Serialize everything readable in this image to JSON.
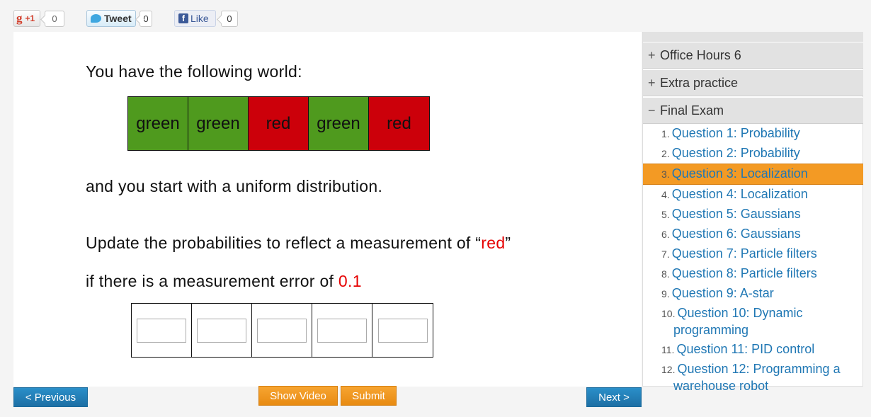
{
  "social": {
    "gplus_label": "+1",
    "gplus_count": "0",
    "tweet_label": "Tweet",
    "tweet_count": "0",
    "like_label": "Like",
    "like_count": "0"
  },
  "question": {
    "line1": "You have the following world:",
    "world": [
      {
        "label": "green",
        "color": "#4f9a1e"
      },
      {
        "label": "green",
        "color": "#4f9a1e"
      },
      {
        "label": "red",
        "color": "#cc000a"
      },
      {
        "label": "green",
        "color": "#4f9a1e"
      },
      {
        "label": "red",
        "color": "#cc000a"
      }
    ],
    "line2": "and you start with a uniform distribution.",
    "line3_pre": "Update the probabilities to reflect a measurement of “",
    "line3_red": "red",
    "line3_post": "”",
    "line4_pre": "if there is a measurement error of ",
    "line4_red": "0.1",
    "answers": [
      "",
      "",
      "",
      "",
      ""
    ]
  },
  "buttons": {
    "previous": "< Previous",
    "show_video": "Show Video",
    "submit": "Submit",
    "next": "Next >"
  },
  "sidebar": {
    "sections": [
      {
        "toggle": "+",
        "label": "Office Hours 6"
      },
      {
        "toggle": "+",
        "label": "Extra practice"
      },
      {
        "toggle": "−",
        "label": "Final Exam"
      }
    ],
    "questions": [
      {
        "num": "1.",
        "label": "Question 1: Probability"
      },
      {
        "num": "2.",
        "label": "Question 2: Probability"
      },
      {
        "num": "3.",
        "label": "Question 3: Localization",
        "active": true
      },
      {
        "num": "4.",
        "label": "Question 4: Localization"
      },
      {
        "num": "5.",
        "label": "Question 5: Gaussians"
      },
      {
        "num": "6.",
        "label": "Question 6: Gaussians"
      },
      {
        "num": "7.",
        "label": "Question 7: Particle filters"
      },
      {
        "num": "8.",
        "label": "Question 8: Particle filters"
      },
      {
        "num": "9.",
        "label": "Question 9: A-star"
      },
      {
        "num": "10.",
        "label": "Question 10: Dynamic",
        "cont": "programming"
      },
      {
        "num": "11.",
        "label": "Question 11: PID control"
      },
      {
        "num": "12.",
        "label": "Question 12: Programming a",
        "cont": "warehouse robot"
      }
    ]
  },
  "colors": {
    "accent_blue": "#1f77b4",
    "active_orange": "#f39a24",
    "button_orange": "#f7a531",
    "button_blue": "#2a8fc9",
    "highlight_red": "#e60000"
  }
}
